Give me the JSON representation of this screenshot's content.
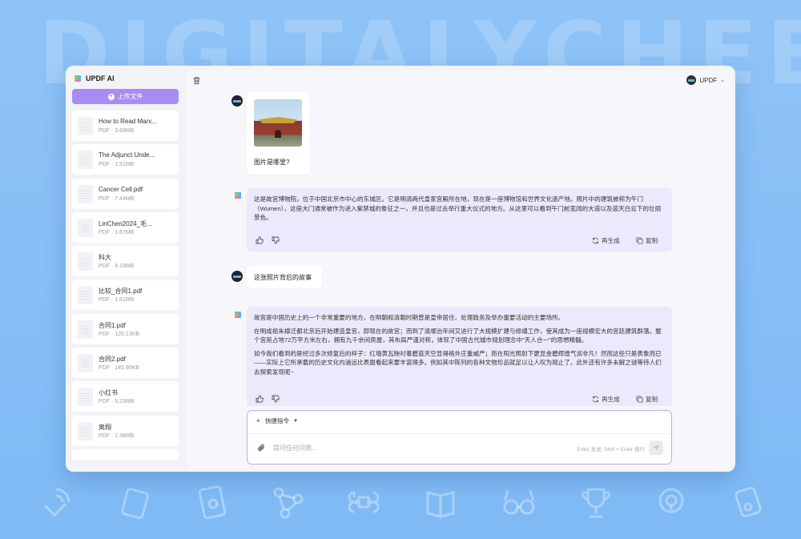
{
  "background": {
    "wordmark": "DIGITALYCHEE"
  },
  "sidebar": {
    "brand_title": "UPDF AI",
    "upload_label": "上传文件",
    "files": [
      {
        "name": "How to Read Marx...",
        "meta": "PDF · 3.68MB"
      },
      {
        "name": "The Adjunct Unde...",
        "meta": "PDF · 1.51MB"
      },
      {
        "name": "Cancer Cell.pdf",
        "meta": "PDF · 7.44MB"
      },
      {
        "name": "LinChen2024_毛...",
        "meta": "PDF · 1.67MB"
      },
      {
        "name": "科大",
        "meta": "PDF · 8.18MB"
      },
      {
        "name": "比较_合同1.pdf",
        "meta": "PDF · 1.61MB"
      },
      {
        "name": "合同1.pdf",
        "meta": "PDF · 120.13KB"
      },
      {
        "name": "合同2.pdf",
        "meta": "PDF · 145.95KB"
      },
      {
        "name": "小红书",
        "meta": "PDF · 5.25MB"
      },
      {
        "name": "奥翔",
        "meta": "PDF · 2.38MB"
      }
    ]
  },
  "header": {
    "user_name": "UPDF"
  },
  "chat": {
    "msg1_question": "图片是哪里?",
    "msg2_answer": "这是故宫博物院，位于中国北京市中心的东城区。它是明清两代皇家宫殿所在地，现在是一座博物馆和世界文化遗产地。照片中的建筑被称为午门（Wumen），这座大门通常被作为进入紫禁城的象征之一，并且也是过去举行重大仪式的地方。从这里可以看到午门前宽阔的大道以及蓝天白云下的壮丽景色。",
    "msg3_question": "这张照片背后的故事",
    "msg4_p1": "故宫是中国历史上的一个非常重要的地方，在明朝和清朝时期曾是皇帝居住、处理政务及举办重要活动的主要场所。",
    "msg4_p2": "在明成祖朱棣迁都北京后开始建造皇宫，即现在的故宫；而到了清顺治年间又进行了大规模扩建与修缮工作，使其成为一座规模宏大的宫廷建筑群落。整个宫苑占地72万平方米左右，拥有九千余间房屋，其布局严谨对称，体现了中国古代城市规划理念中\"天人合一\"的思想精髓。",
    "msg4_p3": "如今我们看到的是经过多次修复后的样子：红墙黄瓦映衬着碧蓝天空显得格外庄重威严；而在阳光照射下更显金碧辉煌气派非凡！然而这些只是表象而已——实际上它所承载的历史文化内涵远比表面看起来要丰富得多。例如其中陈列的各种文物珍品就足以让人叹为观止了。此外还有许多未解之谜等待人们去探索发现呢~",
    "regenerate_label": "再生成",
    "copy_label": "复制"
  },
  "composer": {
    "quick_command_label": "快捷指令",
    "placeholder": "提问任何问题...",
    "hint": "Enter 发送; Shift + Enter 换行"
  },
  "colors": {
    "accent": "#a98cf3",
    "ai_bubble": "#ebe9fb",
    "background": "#8ec3f7"
  }
}
